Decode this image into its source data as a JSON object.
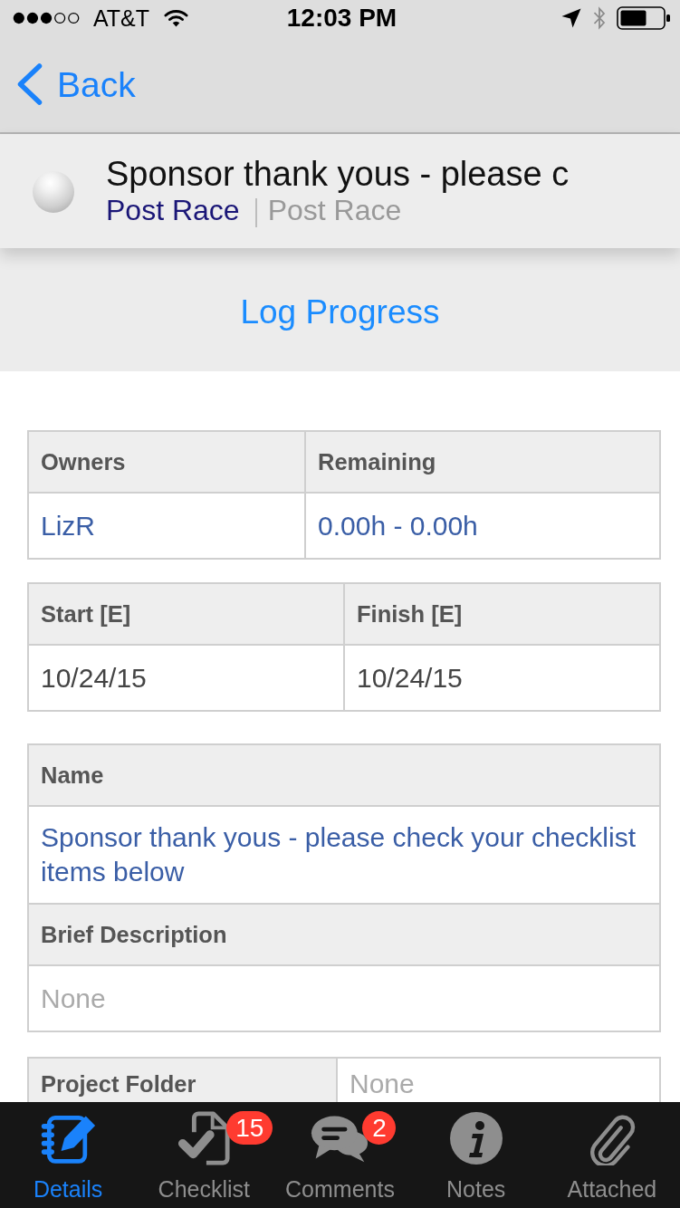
{
  "status_bar": {
    "carrier": "AT&T",
    "time": "12:03 PM"
  },
  "nav_bar": {
    "back": "Back"
  },
  "task_header": {
    "title": "Sponsor thank yous - please c",
    "project": "Post Race",
    "folder": "Post Race"
  },
  "log_progress": {
    "label": "Log Progress"
  },
  "detail_tables": [
    {
      "kind": "columns",
      "cells": [
        {
          "header": "Owners",
          "value": "LizR",
          "kind": "link"
        },
        {
          "header": "Remaining",
          "value": "0.00h - 0.00h",
          "kind": "link"
        }
      ]
    },
    {
      "kind": "columns",
      "cells": [
        {
          "header": "Start [E]",
          "value": "10/24/15",
          "kind": "text"
        },
        {
          "header": "Finish [E]",
          "value": "10/24/15",
          "kind": "text"
        }
      ]
    },
    {
      "kind": "stacked",
      "cells": [
        {
          "header": "Name",
          "value": "Sponsor thank yous - please check your checklist items below",
          "kind": "link"
        },
        {
          "header": "Brief Description",
          "value": "None",
          "kind": "empty"
        }
      ]
    },
    {
      "kind": "inline",
      "cells": [
        {
          "header": "Project Folder",
          "value": "None",
          "kind": "empty"
        }
      ]
    }
  ],
  "tab_bar": {
    "tabs": [
      {
        "label": "Details",
        "selected": true
      },
      {
        "label": "Checklist",
        "selected": false,
        "badge": "15"
      },
      {
        "label": "Comments",
        "selected": false,
        "badge": "2"
      },
      {
        "label": "Notes",
        "selected": false
      },
      {
        "label": "Attached",
        "selected": false
      }
    ]
  }
}
